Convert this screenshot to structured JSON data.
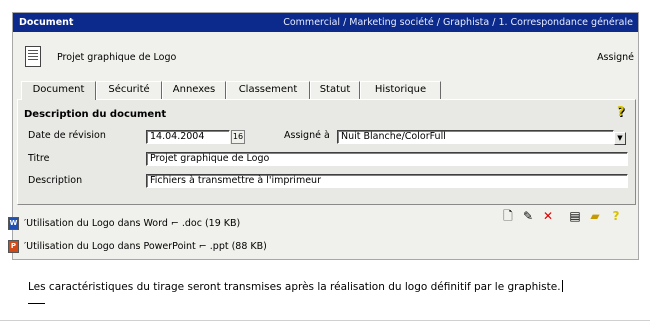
{
  "window": {
    "title": "Document",
    "breadcrumb": "Commercial / Marketing société / Graphista / 1. Correspondance générale"
  },
  "document": {
    "name": "Projet graphique de Logo",
    "status": "Assigné"
  },
  "tabs": [
    {
      "label": "Document",
      "active": true
    },
    {
      "label": "Sécurité",
      "active": false
    },
    {
      "label": "Annexes",
      "active": false
    },
    {
      "label": "Classement",
      "active": false
    },
    {
      "label": "Statut",
      "active": false
    },
    {
      "label": "Historique",
      "active": false
    }
  ],
  "description_panel": {
    "title": "Description du document",
    "help_icon": "question-mark-icon",
    "revision_date_label": "Date de révision",
    "revision_date_value": "14.04.2004",
    "calendar_button": "16",
    "assigned_to_label": "Assigné à",
    "assigned_to_value": "Nuit Blanche/ColorFull",
    "title_label": "Titre",
    "title_value": "Projet graphique de Logo",
    "description_label": "Description",
    "description_value": "Fichiers à transmettre à l'imprimeur"
  },
  "toolbar": {
    "icons": [
      "new-document-icon",
      "attach-icon",
      "delete-icon",
      "scan-icon",
      "open-folder-icon",
      "help-icon"
    ]
  },
  "attachments": [
    {
      "icon": "word-icon",
      "icon_color": "#1f4fb4",
      "text": "′Utilisation du Logo dans Word ⌐ .doc (19 KB)"
    },
    {
      "icon": "powerpoint-icon",
      "icon_color": "#d24a18",
      "text": "′Utilisation du Logo dans PowerPoint ⌐ .ppt (88 KB)"
    }
  ],
  "body_text": "Les caractéristiques du tirage seront transmises après la réalisation du logo définitif par le graphiste.",
  "colors": {
    "titlebar": "#0b2a8c",
    "panel": "#e8e8e4",
    "help_yellow": "#d7c200"
  }
}
